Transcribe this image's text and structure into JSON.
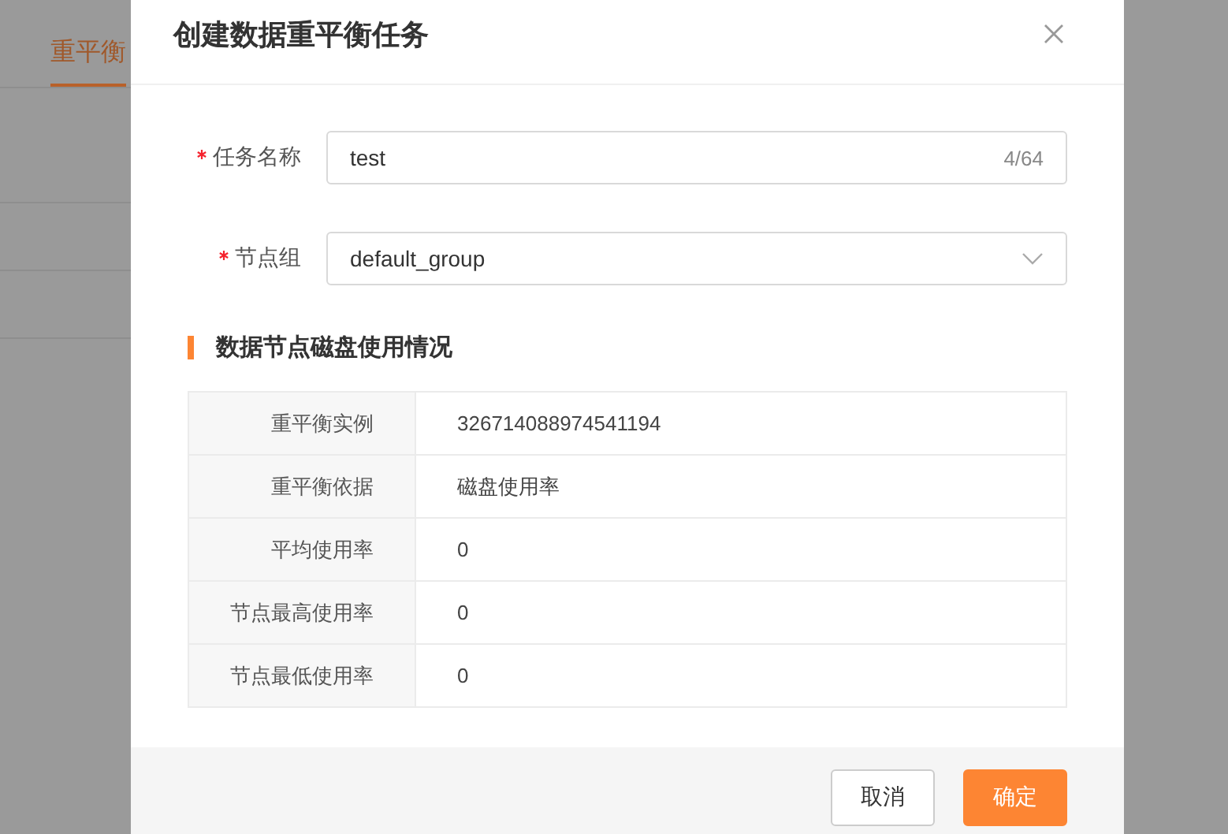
{
  "background_page": {
    "tabs": [
      {
        "label": "重平衡",
        "selected": true
      }
    ]
  },
  "dialog": {
    "title": "创建数据重平衡任务",
    "fields": [
      {
        "kind": "text",
        "label": "任务名称",
        "required": true,
        "value": "test",
        "counter": "4/64"
      },
      {
        "kind": "select",
        "label": "节点组",
        "required": true,
        "value": "default_group"
      }
    ],
    "section_title": "数据节点磁盘使用情况",
    "info_rows": [
      {
        "label": "重平衡实例",
        "value": "326714088974541194"
      },
      {
        "label": "重平衡依据",
        "value": "磁盘使用率"
      },
      {
        "label": "平均使用率",
        "value": "0"
      },
      {
        "label": "节点最高使用率",
        "value": "0"
      },
      {
        "label": "节点最低使用率",
        "value": "0"
      }
    ],
    "buttons": [
      {
        "label": "取消",
        "kind": "secondary"
      },
      {
        "label": "确定",
        "kind": "primary"
      }
    ]
  }
}
